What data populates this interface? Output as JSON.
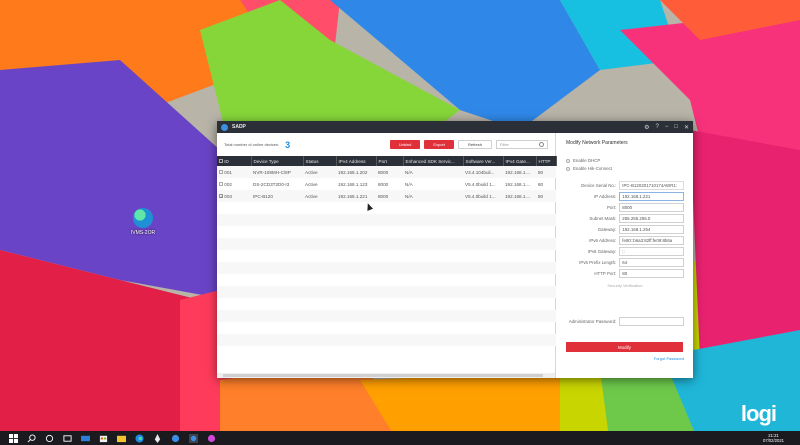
{
  "window": {
    "title": "SADP",
    "controls": [
      "⚙",
      "?",
      "−",
      "□",
      "✕"
    ]
  },
  "desktop": {
    "icon_label": "IVMS-2OR"
  },
  "toolbar": {
    "total_label": "Total number of online devices:",
    "total_count": "3",
    "unbind": "Unbind",
    "export": "Export",
    "refresh": "Refresh",
    "filter_placeholder": "Filter"
  },
  "table": {
    "headers": [
      "ID",
      "Device Type",
      "Status",
      "IPv4 Address",
      "Port",
      "Enhanced SDK Servic...",
      "Software Ver...",
      "IPv4 Gate...",
      "HTTP"
    ],
    "rows": [
      {
        "checked": false,
        "id": "001",
        "type": "NVR-108MH-C/8P",
        "status": "Active",
        "ip": "192.168.1.202",
        "port": "8000",
        "sdk": "N/A",
        "sw": "V3.4.104buil...",
        "gw": "192.168.1....",
        "http": "80"
      },
      {
        "checked": false,
        "id": "002",
        "type": "DS-2CD3T2D0-I3",
        "status": "Active",
        "ip": "192.168.1.123",
        "port": "8000",
        "sdk": "N/A",
        "sw": "V5.4.0build 1...",
        "gw": "192.168.1....",
        "http": "80"
      },
      {
        "checked": true,
        "id": "003",
        "type": "IPC-B120",
        "status": "Active",
        "ip": "192.168.1.221",
        "port": "8000",
        "sdk": "N/A",
        "sw": "V5.4.0build 1...",
        "gw": "192.168.1....",
        "http": "80"
      }
    ]
  },
  "panel": {
    "title": "Modify Network Parameters",
    "enable_dhcp": "Enable DHCP",
    "enable_hik": "Enable Hik-Connect",
    "fields": [
      {
        "label": "Device Serial No.:",
        "value": "IPC-B120201710174AWR1:"
      },
      {
        "label": "IP Address:",
        "value": "192.168.1.221"
      },
      {
        "label": "Port:",
        "value": "8000"
      },
      {
        "label": "Subnet Mask:",
        "value": "255.255.255.0"
      },
      {
        "label": "Gateway:",
        "value": "192.168.1.254"
      },
      {
        "label": "IPv6 Address:",
        "value": "fe80::b6a3:82ff:fe09:8b6a"
      },
      {
        "label": "IPv6 Gateway:",
        "value": "::"
      },
      {
        "label": "IPv6 Prefix Length:",
        "value": "64"
      },
      {
        "label": "HTTP Port:",
        "value": "80"
      }
    ],
    "security_verification": "Security Verification",
    "admin_password_label": "Administrator Password:",
    "admin_password_value": "",
    "modify": "Modify",
    "forgot": "Forgot Password"
  },
  "taskbar": {
    "time": "21:21",
    "date": "07/02/2021"
  },
  "watermark": "logi"
}
